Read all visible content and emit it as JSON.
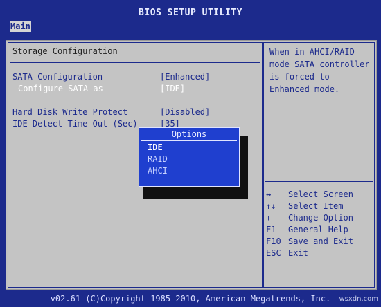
{
  "title": "BIOS SETUP UTILITY",
  "menu": {
    "tabs": [
      {
        "label": "Main"
      }
    ]
  },
  "main": {
    "heading": "Storage Configuration",
    "settings": [
      {
        "label": "SATA Configuration",
        "value": "[Enhanced]"
      },
      {
        "label": "Configure SATA as",
        "value": "[IDE]"
      },
      {
        "label": "Hard Disk Write Protect",
        "value": "[Disabled]"
      },
      {
        "label": "IDE Detect Time Out (Sec)",
        "value": "[35]"
      }
    ]
  },
  "help": {
    "text": "When in AHCI/RAID mode SATA controller is forced to Enhanced mode.",
    "keys": [
      {
        "key": "↔",
        "desc": "Select Screen"
      },
      {
        "key": "↑↓",
        "desc": "Select Item"
      },
      {
        "key": "+-",
        "desc": "Change Option"
      },
      {
        "key": "F1",
        "desc": "General Help"
      },
      {
        "key": "F10",
        "desc": "Save and Exit"
      },
      {
        "key": "ESC",
        "desc": "Exit"
      }
    ]
  },
  "popup": {
    "title": "Options",
    "options": [
      "IDE",
      "RAID",
      "AHCI"
    ],
    "selected": "IDE"
  },
  "footer": {
    "text": "v02.61 (C)Copyright 1985-2010, American Megatrends, Inc."
  },
  "watermark": "wsxdn.com",
  "colors": {
    "background": "#1c2a8c",
    "panel": "#c4c4c4",
    "popup": "#1f3fcf",
    "highlight_text": "#ffffff"
  }
}
